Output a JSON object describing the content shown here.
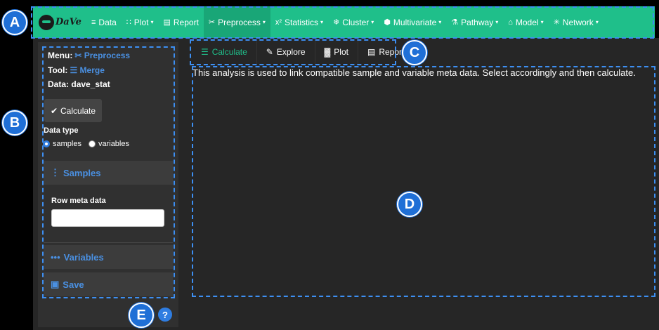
{
  "brand": {
    "logo_text": "DaVe"
  },
  "nav": {
    "items": [
      {
        "label": "Data",
        "icon": "database-icon",
        "glyph": "≡",
        "caret": false,
        "active": false
      },
      {
        "label": "Plot",
        "icon": "grid-icon",
        "glyph": "∷",
        "caret": true,
        "active": false
      },
      {
        "label": "Report",
        "icon": "file-icon",
        "glyph": "▤",
        "caret": false,
        "active": false
      },
      {
        "label": "Preprocess",
        "icon": "scissors-icon",
        "glyph": "✂",
        "caret": true,
        "active": true
      },
      {
        "label": "Statistics",
        "icon": "superscript-icon",
        "glyph": "x²",
        "caret": true,
        "active": false
      },
      {
        "label": "Cluster",
        "icon": "snowflake-icon",
        "glyph": "❄",
        "caret": true,
        "active": false
      },
      {
        "label": "Multivariate",
        "icon": "cube-icon",
        "glyph": "⬢",
        "caret": true,
        "active": false
      },
      {
        "label": "Pathway",
        "icon": "flask-icon",
        "glyph": "⚗",
        "caret": true,
        "active": false
      },
      {
        "label": "Model",
        "icon": "bank-icon",
        "glyph": "⌂",
        "caret": true,
        "active": false
      },
      {
        "label": "Network",
        "icon": "share-icon",
        "glyph": "✳",
        "caret": true,
        "active": false
      }
    ],
    "caret_glyph": "▾"
  },
  "sidebar": {
    "menu_label": "Menu:",
    "menu_value": "Preprocess",
    "tool_label": "Tool:",
    "tool_value": "Merge",
    "data_label": "Data:",
    "data_value": "dave_stat",
    "calculate_label": "Calculate",
    "data_type_label": "Data type",
    "data_type_options": [
      {
        "label": "samples",
        "selected": true
      },
      {
        "label": "variables",
        "selected": false
      }
    ],
    "samples_panel_label": "Samples",
    "row_meta_label": "Row meta data",
    "row_meta_value": "",
    "variables_panel_label": "Variables",
    "save_label": "Save",
    "help_glyph": "?"
  },
  "tabs": [
    {
      "label": "Calculate",
      "icon": "sliders-icon",
      "glyph": "☰",
      "active": true
    },
    {
      "label": "Explore",
      "icon": "edit-icon",
      "glyph": "✎",
      "active": false
    },
    {
      "label": "Plot",
      "icon": "bar-chart-icon",
      "glyph": "▓",
      "active": false
    },
    {
      "label": "Report",
      "icon": "file-icon",
      "glyph": "▤",
      "active": false
    }
  ],
  "main": {
    "description": "This analysis is used to link compatible sample and variable meta data. Select accordingly and then calculate."
  },
  "annotations": {
    "a": "A",
    "b": "B",
    "c": "C",
    "d": "D",
    "e": "E"
  },
  "colors": {
    "accent": "#1fbf8a",
    "link": "#4a90e2",
    "badge": "#1f6fd6"
  }
}
